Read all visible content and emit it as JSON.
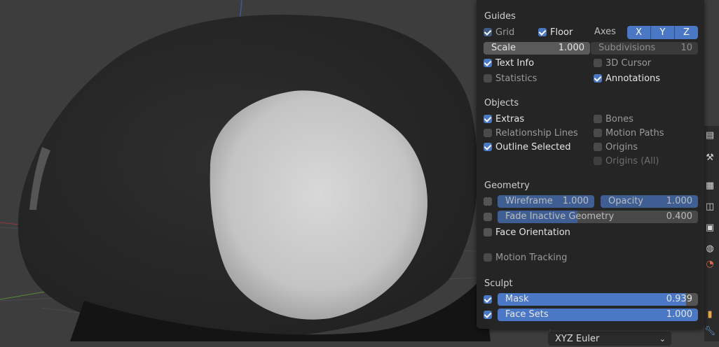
{
  "guides": {
    "title": "Guides",
    "grid_label": "Grid",
    "floor_label": "Floor",
    "axes_label": "Axes",
    "axes": [
      "X",
      "Y",
      "Z"
    ],
    "scale_label": "Scale",
    "scale_value": "1.000",
    "subdivisions_label": "Subdivisions",
    "subdivisions_value": "10",
    "text_info_label": "Text Info",
    "cursor_label": "3D Cursor",
    "statistics_label": "Statistics",
    "annotations_label": "Annotations"
  },
  "objects": {
    "title": "Objects",
    "extras_label": "Extras",
    "bones_label": "Bones",
    "relationship_lines_label": "Relationship Lines",
    "motion_paths_label": "Motion Paths",
    "outline_selected_label": "Outline Selected",
    "origins_label": "Origins",
    "origins_all_label": "Origins (All)"
  },
  "geometry": {
    "title": "Geometry",
    "wireframe_label": "Wireframe",
    "wireframe_value": "1.000",
    "opacity_label": "Opacity",
    "opacity_value": "1.000",
    "fade_label": "Fade Inactive Geometry",
    "fade_value": "0.400",
    "fade_fraction": 0.4,
    "face_orientation_label": "Face Orientation"
  },
  "motion_tracking": {
    "label": "Motion Tracking"
  },
  "sculpt": {
    "title": "Sculpt",
    "mask_label": "Mask",
    "mask_value": "0.939",
    "mask_fraction": 0.939,
    "face_sets_label": "Face Sets",
    "face_sets_value": "1.000"
  },
  "properties": {
    "rotation_mode": "XYZ Euler"
  },
  "colors": {
    "accent": "#4a78c4",
    "panel": "#242424",
    "viewport": "#3d3d3d"
  }
}
